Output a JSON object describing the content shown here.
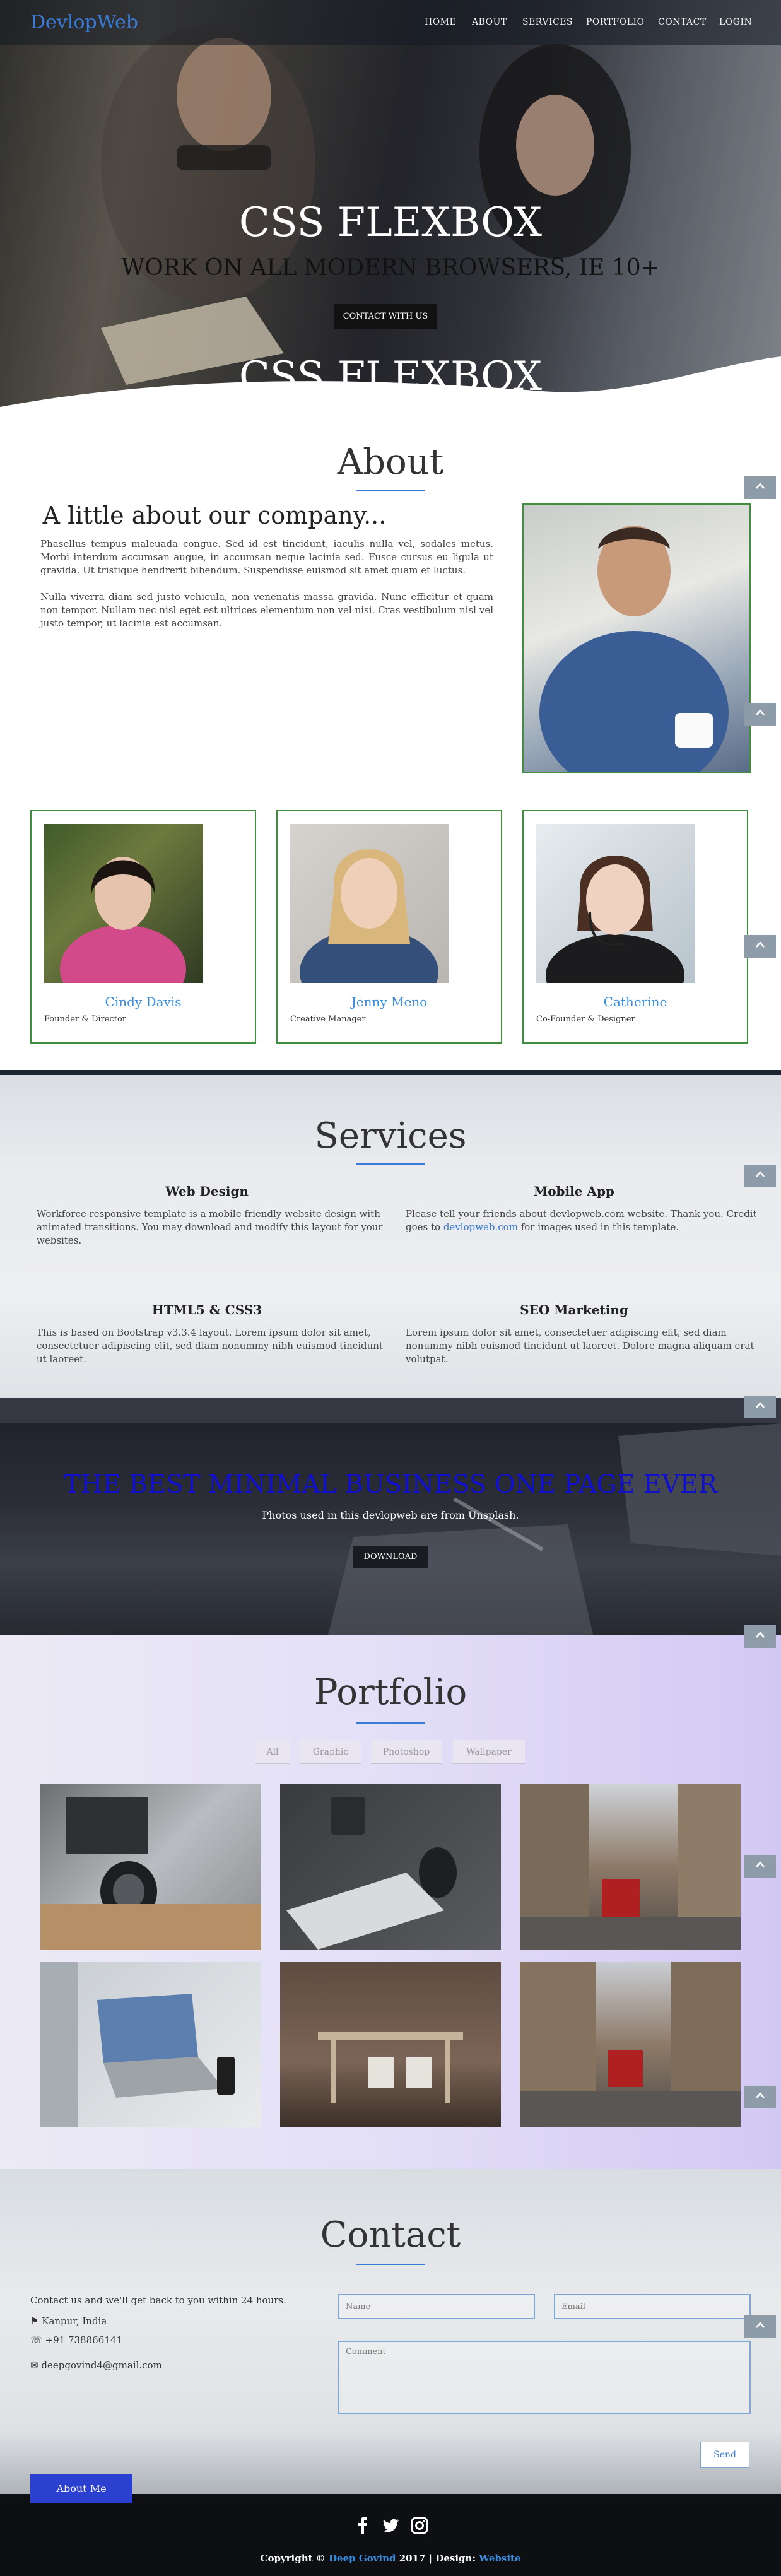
{
  "nav": {
    "brand": "DevlopWeb",
    "links": [
      "HOME",
      "ABOUT",
      "SERVICES",
      "PORTFOLIO",
      "CONTACT",
      "LOGIN"
    ]
  },
  "hero": {
    "title": "CSS FLEXBOX",
    "subtitle": "WORK ON ALL MODERN BROWSERS, IE 10+",
    "button": "CONTACT WITH US"
  },
  "about": {
    "title": "About",
    "subtitle": "A little about our company...",
    "paragraphs": [
      "Phasellus tempus maleuada congue. Sed id est tincidunt, iaculis nulla vel, sodales metus. Morbi interdum accumsan augue, in accumsan neque lacinia sed. Fusce cursus eu ligula ut gravida. Ut tristique hendrerit bibendum. Suspendisse euismod sit amet quam et luctus.",
      "Nulla viverra diam sed justo vehicula, non venenatis massa gravida. Nunc efficitur et quam non tempor. Nullam nec nisl eget est ultrices elementum non vel nisi. Cras vestibulum nisl vel justo tempor, ut lacinia est accumsan."
    ]
  },
  "team": [
    {
      "name": "Cindy Davis",
      "role": "Founder & Director"
    },
    {
      "name": "Jenny Meno",
      "role": "Creative Manager"
    },
    {
      "name": "Catherine",
      "role": "Co-Founder & Designer"
    }
  ],
  "services": {
    "title": "Services",
    "items": [
      {
        "title": "Web Design",
        "text": "Workforce responsive template is a mobile friendly website design with animated transitions. You may download and modify this layout for your websites."
      },
      {
        "title": "Mobile App",
        "text_before": "Please tell your friends about devlopweb.com website. Thank you. Credit goes to ",
        "link": "devlopweb.com",
        "text_after": " for images used in this template."
      },
      {
        "title": "HTML5 & CSS3",
        "text": "This is based on Bootstrap v3.3.4 layout. Lorem ipsum dolor sit amet, consectetuer adipiscing elit, sed diam nonummy nibh euismod tincidunt ut laoreet."
      },
      {
        "title": "SEO Marketing",
        "text": "Lorem ipsum dolor sit amet, consectetuer adipiscing elit, sed diam nonummy nibh euismod tincidunt ut laoreet. Dolore magna aliquam erat volutpat."
      }
    ]
  },
  "minimal": {
    "title": "THE BEST MINIMAL BUSINESS ONE PAGE EVER",
    "subtitle": "Photos used in this devlopweb are from Unsplash.",
    "button": "DOWNLOAD"
  },
  "portfolio": {
    "title": "Portfolio",
    "filters": [
      "All",
      "Graphic",
      "Photoshop",
      "Wallpaper"
    ]
  },
  "contact": {
    "title": "Contact",
    "intro": "Contact us and we'll get back to you within 24 hours.",
    "location": "Kanpur, India",
    "phone": "+91 738866141",
    "email": "deepgovind4@gmail.com",
    "name_placeholder": "Name",
    "email_placeholder": "Email",
    "comment_placeholder": "Comment",
    "send": "Send",
    "about_me": "About Me"
  },
  "footer": {
    "copyright": "Copyright ©",
    "author": "Deep Govind",
    "year_design": "2017 | Design:",
    "design_link": "Website"
  },
  "colors": {
    "accent": "#3a7bd5",
    "green_border": "#3f8f3f",
    "minimal_title": "#1010cc",
    "up_button": "#8e9ba8"
  }
}
